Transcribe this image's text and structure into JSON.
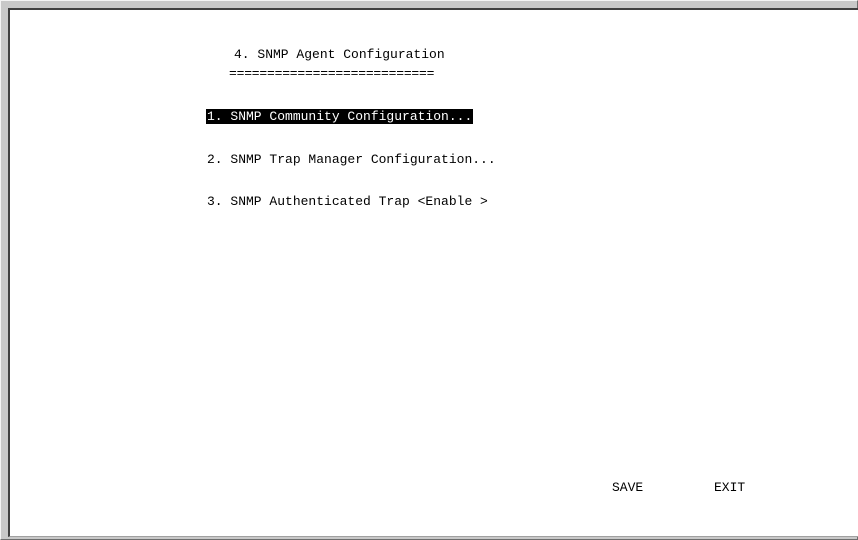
{
  "screen": {
    "title": "4. SNMP Agent Configuration",
    "title_underline": "==========================="
  },
  "menu": {
    "items": [
      {
        "label": "1. SNMP Community Configuration...",
        "selected": true
      },
      {
        "label": "2. SNMP Trap Manager Configuration...",
        "selected": false
      },
      {
        "label": "3. SNMP Authenticated Trap <Enable >",
        "selected": false
      }
    ]
  },
  "commands": {
    "save_label": "SAVE",
    "exit_label": "EXIT"
  },
  "colors": {
    "background": "#ffffff",
    "text": "#000000",
    "highlight_bg": "#000000",
    "highlight_text": "#ffffff",
    "frame": "#c8c8c8"
  }
}
